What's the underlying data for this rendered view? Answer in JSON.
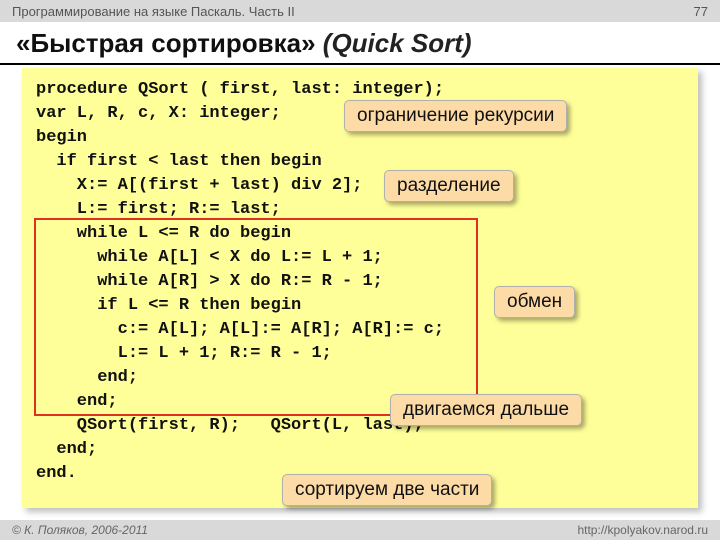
{
  "topbar": {
    "left": "Программирование на языке Паскаль. Часть II",
    "page": "77"
  },
  "title": {
    "main": "«Быстрая сортировка»",
    "italic": "(Quick Sort)"
  },
  "code": {
    "l1": "procedure QSort ( first, last: integer);",
    "l2": "var L, R, c, X: integer;",
    "l3": "begin",
    "l4": "  if first < last then begin",
    "l5": "    X:= A[(first + last) div 2];",
    "l6": "    L:= first; R:= last;",
    "l7": "    while L <= R do begin",
    "l8": "      while A[L] < X do L:= L + 1;",
    "l9": "      while A[R] > X do R:= R - 1;",
    "l10": "      if L <= R then begin",
    "l11": "        c:= A[L]; A[L]:= A[R]; A[R]:= c;",
    "l12": "        L:= L + 1; R:= R - 1;",
    "l13": "      end;",
    "l14": "    end;",
    "l15": "    QSort(first, R);   QSort(L, last);",
    "l16": "  end;",
    "l17": "end."
  },
  "callouts": {
    "recursion": "ограничение рекурсии",
    "partition": "разделение",
    "swap": "обмен",
    "advance": "двигаемся дальше",
    "recurse": "сортируем две части"
  },
  "footer": {
    "left": "© К. Поляков, 2006-2011",
    "right": "http://kpolyakov.narod.ru"
  }
}
